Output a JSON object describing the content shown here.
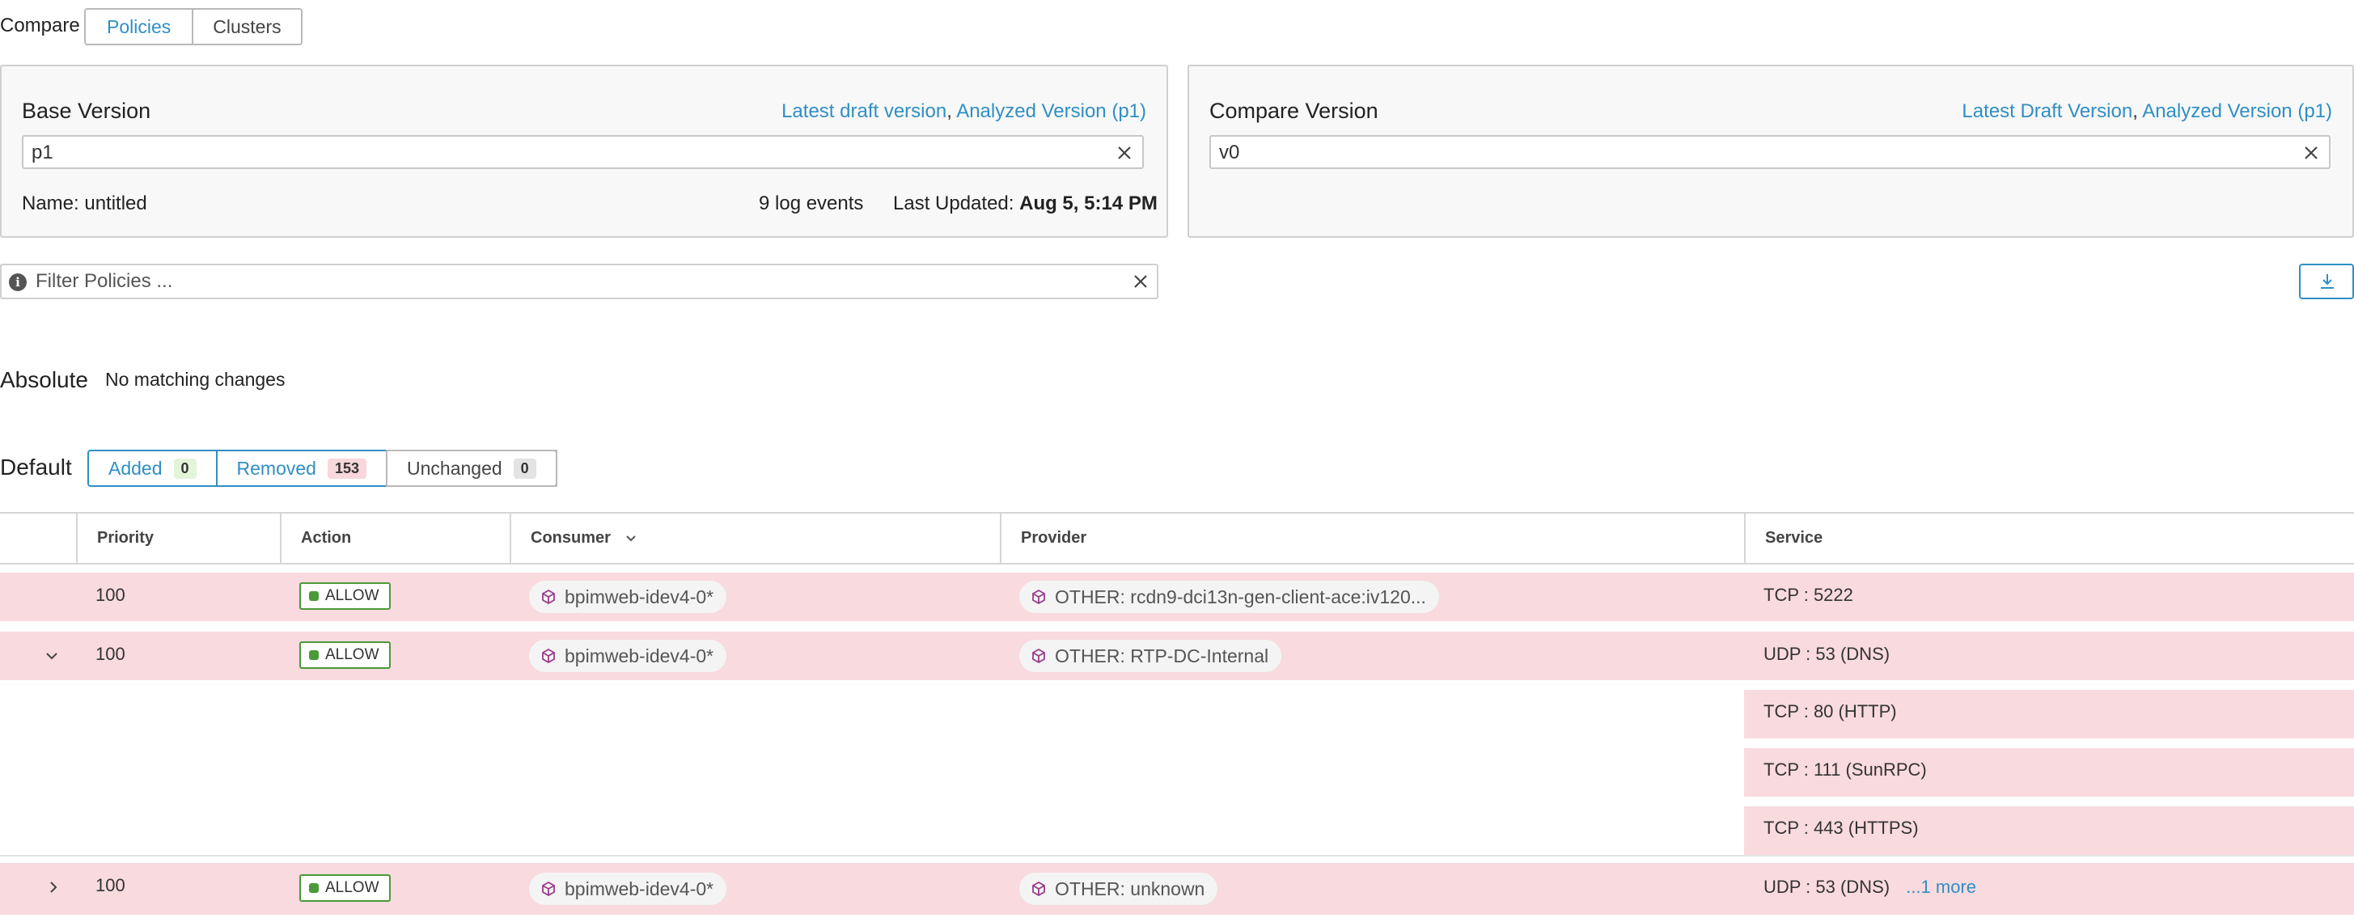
{
  "compare": {
    "label": "Compare",
    "options": [
      "Policies",
      "Clusters"
    ],
    "selected": "Policies"
  },
  "base": {
    "title": "Base Version",
    "link_latest": "Latest draft version",
    "link_sep": ", ",
    "link_analyzed": "Analyzed Version (p1)",
    "value": "p1",
    "name": "Name: untitled",
    "log_events": "9 log events",
    "last_updated_label": "Last Updated:",
    "last_updated_value": "Aug 5, 5:14 PM"
  },
  "compare_version": {
    "title": "Compare Version",
    "link_latest": "Latest Draft Version",
    "link_sep": ", ",
    "link_analyzed": "Analyzed Version (p1)",
    "value": "v0"
  },
  "filter": {
    "placeholder": "Filter Policies ...",
    "info_glyph": "i"
  },
  "absolute": {
    "label": "Absolute",
    "note": "No matching changes"
  },
  "default": {
    "label": "Default",
    "tabs": [
      {
        "label": "Added",
        "count": "0"
      },
      {
        "label": "Removed",
        "count": "153"
      },
      {
        "label": "Unchanged",
        "count": "0"
      }
    ]
  },
  "table": {
    "columns": [
      "Priority",
      "Action",
      "Consumer",
      "Provider",
      "Service"
    ],
    "rows": [
      {
        "priority": "100",
        "action": "ALLOW",
        "consumer": "bpimweb-idev4-0*",
        "provider": "OTHER: rcdn9-dci13n-gen-client-ace:iv120...",
        "services": [
          "TCP : 5222"
        ]
      },
      {
        "priority": "100",
        "action": "ALLOW",
        "consumer": "bpimweb-idev4-0*",
        "provider": "OTHER: RTP-DC-Internal",
        "services": [
          "UDP : 53 (DNS)",
          "TCP : 80 (HTTP)",
          "TCP : 111 (SunRPC)",
          "TCP : 443 (HTTPS)"
        ]
      },
      {
        "priority": "100",
        "action": "ALLOW",
        "consumer": "bpimweb-idev4-0*",
        "provider": "OTHER: unknown",
        "services": [
          "UDP : 53 (DNS)"
        ],
        "more": "...1 more"
      }
    ]
  },
  "colors": {
    "accent": "#2f8fc4",
    "removed_row": "#f8dadf",
    "allow_green": "#4a9a38",
    "cube_purple": "#9b3a8c"
  }
}
